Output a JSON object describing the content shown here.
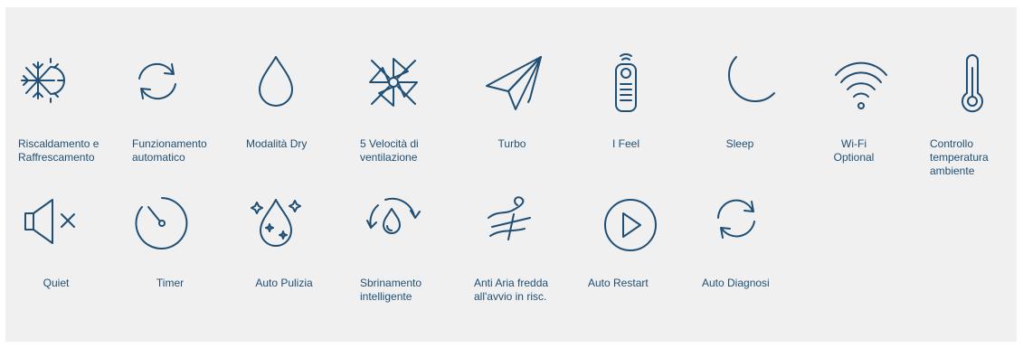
{
  "features": [
    {
      "label": "Riscaldamento e\nRaffrescamento",
      "icon": "sun-snowflake-icon"
    },
    {
      "label": "Funzionamento\nautomatico",
      "icon": "auto-cycle-icon"
    },
    {
      "label": "Modalità Dry",
      "icon": "water-drop-icon"
    },
    {
      "label": "5 Velocità di\nventilazione",
      "icon": "pinwheel-icon"
    },
    {
      "label": "Turbo",
      "icon": "paper-plane-icon"
    },
    {
      "label": "I Feel",
      "icon": "remote-control-icon"
    },
    {
      "label": "Sleep",
      "icon": "moon-icon"
    },
    {
      "label": "Wi-Fi\nOptional",
      "icon": "wifi-icon"
    },
    {
      "label": "Controllo\ntemperatura\nambiente",
      "icon": "thermometer-icon"
    },
    {
      "label": "Quiet",
      "icon": "speaker-mute-icon"
    },
    {
      "label": "Timer",
      "icon": "timer-icon"
    },
    {
      "label": "Auto Pulizia",
      "icon": "sparkle-drop-icon"
    },
    {
      "label": "Sbrinamento\nintelligente",
      "icon": "drop-cycle-icon"
    },
    {
      "label": "Anti Aria fredda\nall'avvio in risc.",
      "icon": "wind-icon"
    },
    {
      "label": "Auto Restart",
      "icon": "play-circle-icon"
    },
    {
      "label": "Auto Diagnosi",
      "icon": "diagnosis-cycle-icon"
    }
  ],
  "colors": {
    "icon": "#1f4f74",
    "background": "#f0f0f0"
  }
}
